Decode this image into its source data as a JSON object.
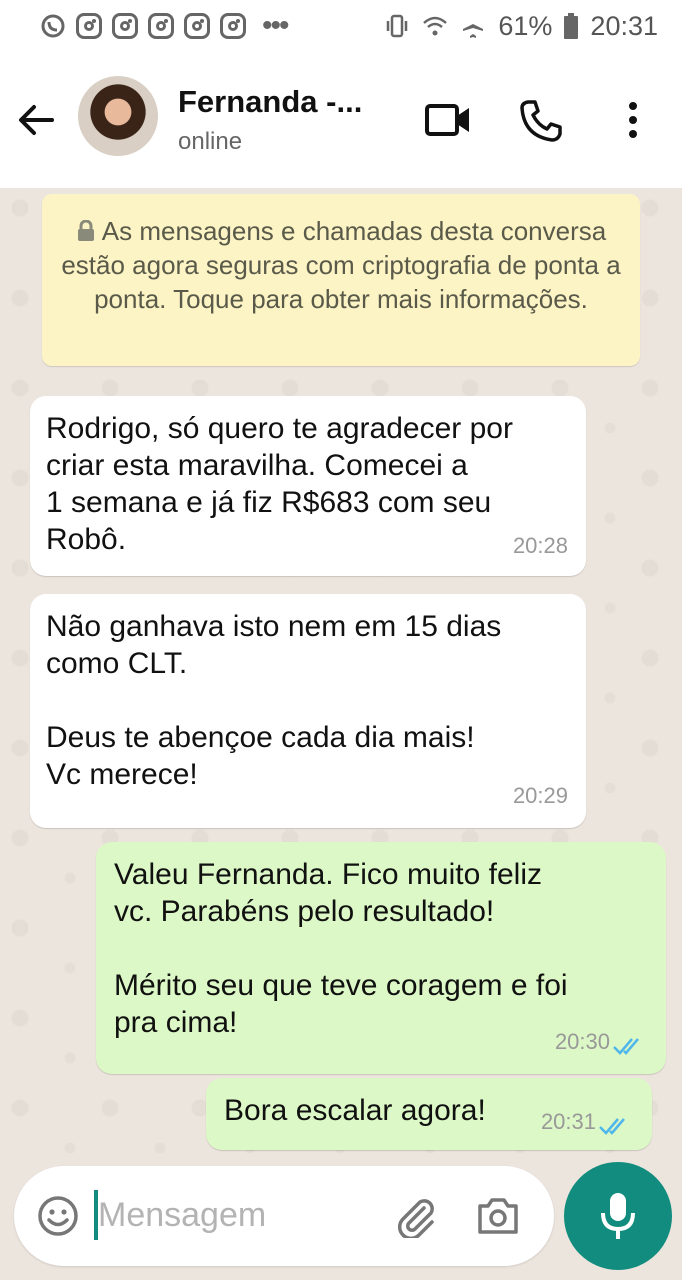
{
  "status_bar": {
    "battery": "61%",
    "time": "20:31",
    "icons": [
      "whatsapp-call-icon",
      "instagram-icon",
      "instagram-icon",
      "instagram-icon",
      "instagram-icon",
      "instagram-icon",
      "more-dots-icon",
      "vibrate-icon",
      "wifi-icon",
      "airplane-icon",
      "battery-icon"
    ]
  },
  "header": {
    "contact_name": "Fernanda -...",
    "status": "online"
  },
  "chat": {
    "encryption_notice": "As mensagens e chamadas desta conversa estão agora seguras com criptografia de ponta a ponta. Toque para obter mais informações.",
    "messages": [
      {
        "direction": "in",
        "text": "Rodrigo, só quero te agradecer por\ncriar esta maravilha. Comecei a\n1 semana e já fiz R$683 com seu\nRobô.",
        "time": "20:28"
      },
      {
        "direction": "in",
        "text": "Não ganhava isto nem em 15 dias\ncomo CLT.\n\nDeus te abençoe cada dia mais!\nVc merece!",
        "time": "20:29"
      },
      {
        "direction": "out",
        "text": "Valeu Fernanda. Fico muito feliz\nvc. Parabéns pelo resultado!\n\nMérito seu que teve coragem e foi\npra cima!",
        "time": "20:30",
        "read": true
      },
      {
        "direction": "out",
        "text": "Bora escalar agora!",
        "time": "20:31",
        "read": true
      }
    ]
  },
  "composer": {
    "placeholder": "Mensagem",
    "value": ""
  },
  "colors": {
    "accent": "#128c7e",
    "outgoing_bubble": "#dcf8c6",
    "notice_bg": "#fdf4c5",
    "read_ticks": "#4fb6ec"
  }
}
